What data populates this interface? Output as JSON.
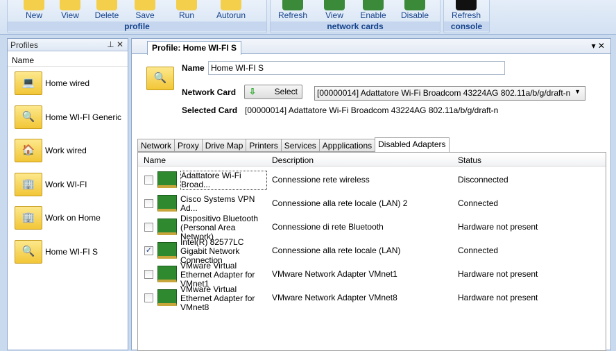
{
  "ribbon": {
    "groups": [
      {
        "label": "profile",
        "buttons": [
          "New",
          "View",
          "Delete",
          "Save",
          "Run",
          "Autorun"
        ]
      },
      {
        "label": "network cards",
        "buttons": [
          "Refresh",
          "View",
          "Enable",
          "Disable"
        ]
      },
      {
        "label": "console",
        "buttons": [
          "Refresh"
        ]
      }
    ]
  },
  "profiles": {
    "title": "Profiles",
    "column": "Name",
    "items": [
      {
        "label": "Home wired",
        "icon": "laptop-icon"
      },
      {
        "label": "Home WI-FI Generic",
        "icon": "magnifier-icon"
      },
      {
        "label": "Work wired",
        "icon": "house-icon"
      },
      {
        "label": "Work WI-FI",
        "icon": "building-icon"
      },
      {
        "label": "Work on Home",
        "icon": "building-icon"
      },
      {
        "label": "Home WI-FI S",
        "icon": "magnifier-icon"
      }
    ]
  },
  "doc": {
    "tab": "Profile: Home WI-FI S",
    "name_label": "Name",
    "name_value": "Home WI-FI S",
    "card_label": "Network Card",
    "select_label": "Select",
    "card_value": "[00000014] Adattatore Wi-Fi Broadcom 43224AG 802.11a/b/g/draft-n",
    "selected_label": "Selected Card",
    "selected_value": "[00000014] Adattatore Wi-Fi Broadcom 43224AG 802.11a/b/g/draft-n",
    "tabs": [
      "Network",
      "Proxy",
      "Drive Map",
      "Printers",
      "Services",
      "Appplications",
      "Disabled Adapters"
    ],
    "columns": [
      "Name",
      "Description",
      "Status"
    ],
    "rows": [
      {
        "checked": false,
        "name": "Adattatore Wi-Fi Broad...",
        "desc": "Connessione rete wireless",
        "status": "Disconnected"
      },
      {
        "checked": false,
        "name": "Cisco Systems VPN Ad...",
        "desc": "Connessione alla rete locale (LAN) 2",
        "status": "Connected"
      },
      {
        "checked": false,
        "name": "Dispositivo Bluetooth (Personal Area Network)",
        "desc": "Connessione di rete Bluetooth",
        "status": "Hardware not present"
      },
      {
        "checked": true,
        "name": "Intel(R) 82577LC Gigabit Network Connection",
        "desc": "Connessione alla rete locale (LAN)",
        "status": "Connected"
      },
      {
        "checked": false,
        "name": "VMware Virtual Ethernet Adapter for VMnet1",
        "desc": "VMware Network Adapter VMnet1",
        "status": "Hardware not present"
      },
      {
        "checked": false,
        "name": "VMware Virtual Ethernet Adapter for VMnet8",
        "desc": "VMware Network Adapter VMnet8",
        "status": "Hardware not present"
      }
    ]
  }
}
